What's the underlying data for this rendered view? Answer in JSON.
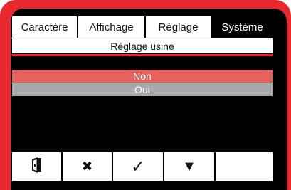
{
  "tabs": [
    {
      "label": "Caractère"
    },
    {
      "label": "Affichage"
    },
    {
      "label": "Réglage"
    },
    {
      "label": "Système"
    }
  ],
  "section": {
    "title": "Réglage usine"
  },
  "options": [
    {
      "label": "Non",
      "selected": true
    },
    {
      "label": "Oui",
      "selected": false
    }
  ],
  "buttons": [
    {
      "icon": "exit-door-icon",
      "glyph": ""
    },
    {
      "icon": "close-icon",
      "glyph": "✖"
    },
    {
      "icon": "check-icon",
      "glyph": "✓"
    },
    {
      "icon": "down-arrow-icon",
      "glyph": "▼"
    },
    {
      "icon": "",
      "glyph": ""
    }
  ],
  "colors": {
    "frame": "#e8282e",
    "selected_row": "#e5625d",
    "unselected_row": "#a9a9a9",
    "screen": "#000000"
  }
}
